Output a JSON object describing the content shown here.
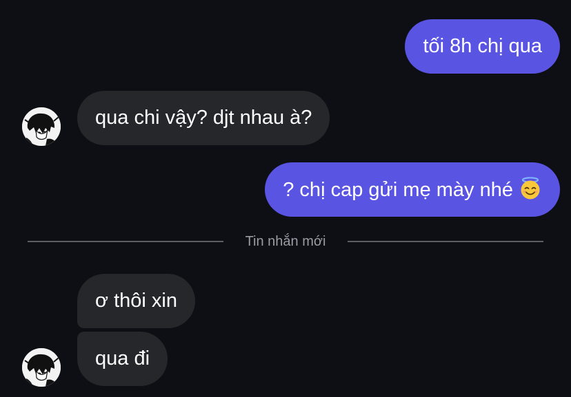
{
  "messages": [
    {
      "direction": "outgoing",
      "text": "tối 8h chị qua"
    },
    {
      "direction": "incoming",
      "text": "qua chi vậy? djt nhau à?"
    },
    {
      "direction": "outgoing",
      "text": "? chị cap gửi mẹ mày nhé",
      "emoji": "smiling-face-with-halo-emoji"
    },
    {
      "direction": "incoming",
      "text": "ơ thôi xin"
    },
    {
      "direction": "incoming",
      "text": "qua đi"
    }
  ],
  "divider": {
    "label": "Tin nhắn mới"
  },
  "colors": {
    "background": "#0d0f14",
    "outgoing_bubble": "#5a54e3",
    "incoming_bubble": "#26272b",
    "divider_line": "#5c5f66",
    "divider_text": "#9a9da4"
  }
}
